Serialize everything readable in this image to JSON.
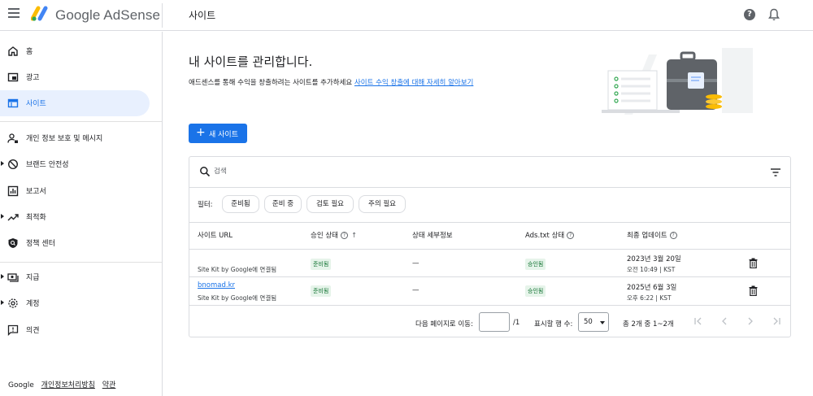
{
  "app": {
    "brand": "Google AdSense",
    "page_title": "사이트"
  },
  "header": {
    "help_symbol": "?"
  },
  "sidebar": {
    "items": [
      {
        "label": "홈",
        "icon": "home-icon"
      },
      {
        "label": "광고",
        "icon": "ads-icon"
      },
      {
        "label": "사이트",
        "icon": "sites-icon",
        "active": true
      },
      {
        "label": "개인 정보 보호 및 메시지",
        "icon": "privacy-icon"
      },
      {
        "label": "브랜드 안전성",
        "icon": "block-icon"
      },
      {
        "label": "보고서",
        "icon": "reports-icon"
      },
      {
        "label": "최적화",
        "icon": "trending-icon"
      },
      {
        "label": "정책 센터",
        "icon": "policy-icon"
      },
      {
        "label": "지급",
        "icon": "payments-icon"
      },
      {
        "label": "계정",
        "icon": "gear-icon"
      },
      {
        "label": "의견",
        "icon": "feedback-icon"
      }
    ],
    "footer": {
      "google": "Google",
      "privacy": "개인정보처리방침",
      "terms": "약관"
    }
  },
  "main": {
    "heading": "내 사이트를 관리합니다.",
    "subtitle": "애드센스를 통해 수익을 창출하려는 사이트를 추가하세요",
    "subtitle_link": "사이트 수익 창출에 대해 자세히 알아보기",
    "new_site_plus": "+",
    "new_site_label": "새 사이트",
    "search": {
      "placeholder": "검색"
    },
    "filter_label": "필터:",
    "filter_chips": [
      "준비됨",
      "준비 중",
      "검토 필요",
      "주의 필요"
    ],
    "table": {
      "headers": {
        "site_url": "사이트 URL",
        "approval": "승인 상태",
        "status_detail": "상태 세부정보",
        "ads_txt": "Ads.txt 상태",
        "last_update": "최종 업데이트"
      },
      "info_symbol": "?",
      "sort_symbol": "↑",
      "rows": [
        {
          "url": "",
          "note": "Site Kit by Google에 연결됨",
          "approval": "준비됨",
          "detail": "—",
          "ads_txt": "승인됨",
          "date": "2023년 3월 20일",
          "time": "오전 10:49 | KST"
        },
        {
          "url": "bnomad.kr",
          "note": "Site Kit by Google에 연결됨",
          "approval": "준비됨",
          "detail": "—",
          "ads_txt": "승인됨",
          "date": "2025년 6월 3일",
          "time": "오후 6:22 | KST"
        }
      ]
    },
    "pagination": {
      "goto_label": "다음 페이지로 이동:",
      "goto_value": "",
      "total_pages": "/1",
      "rows_label": "표시할 행 수:",
      "rows_value": "50",
      "range_label": "총 2개 중 1~2개"
    }
  },
  "colors": {
    "accent": "#1a73e8",
    "badge_bg": "#e6f4ea",
    "badge_fg": "#137333",
    "active_nav_bg": "#e8f0fe"
  }
}
